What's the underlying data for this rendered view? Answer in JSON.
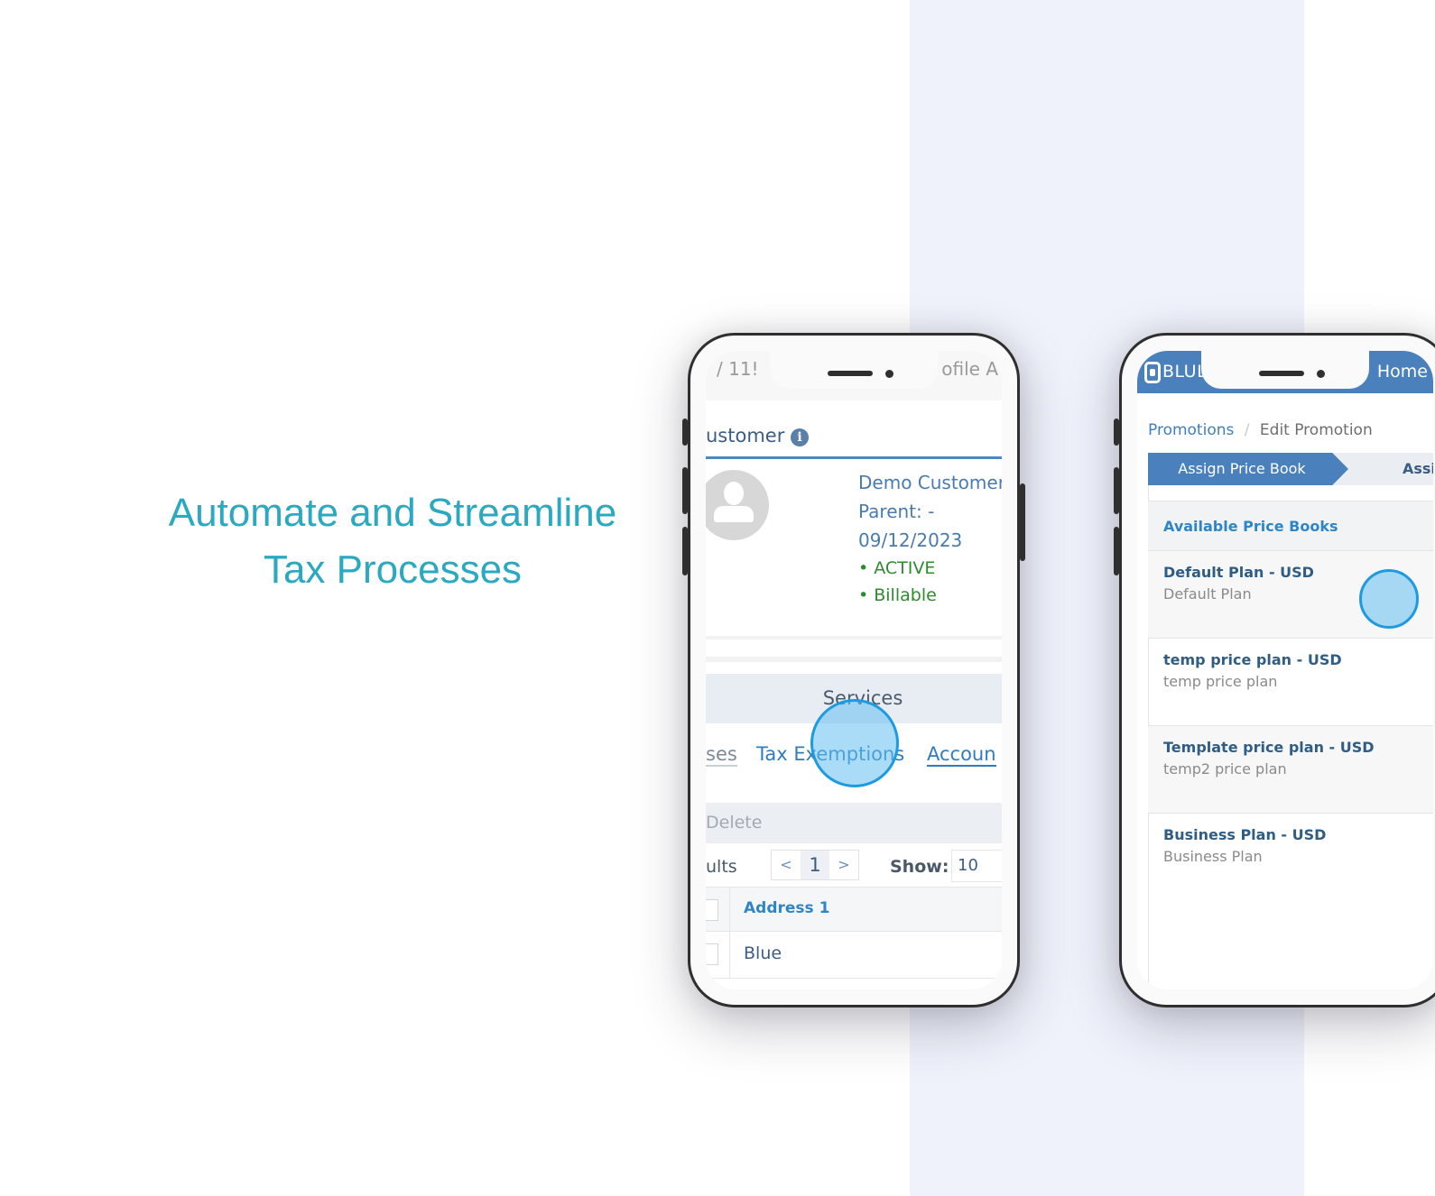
{
  "headline": {
    "line1": "Automate and Streamline",
    "line2": "Tax Processes",
    "color": "#2aa9c0"
  },
  "phone1": {
    "topbar": {
      "left_fragment": "/ 11!",
      "right_fragment": "ofile A"
    },
    "page_title": "ustomer",
    "info_icon": "info-icon",
    "customer": {
      "name": "Demo Customer",
      "parent": "Parent: -",
      "date": "09/12/2023",
      "status_active": "• ACTIVE",
      "status_billable": "• Billable"
    },
    "section_label": "Services",
    "tabs": [
      {
        "label": "ses"
      },
      {
        "label": "Tax Exemptions"
      },
      {
        "label": "Accoun"
      }
    ],
    "delete_label": "Delete",
    "results_label": "ults",
    "pager": {
      "prev": "<",
      "current": "1",
      "next": ">"
    },
    "show_label": "Show:",
    "show_value": "10",
    "table": {
      "header": "Address 1",
      "rows": [
        {
          "address1": "Blue"
        }
      ]
    }
  },
  "phone2": {
    "brand": "BLULOGIX",
    "home_label": "Home",
    "breadcrumb": {
      "parent": "Promotions",
      "separator": "/",
      "current": "Edit Promotion"
    },
    "wizard": {
      "active_step": "Assign Price Book",
      "next_step": "Assi"
    },
    "price_books_title": "Available Price Books",
    "price_books": [
      {
        "name": "Default Plan - USD",
        "description": "Default Plan"
      },
      {
        "name": "temp price plan - USD",
        "description": "temp price plan"
      },
      {
        "name": "Template price plan - USD",
        "description": "temp2 price plan"
      },
      {
        "name": "Business Plan - USD",
        "description": "Business Plan"
      }
    ]
  },
  "colors": {
    "brand_blue": "#4a81bd",
    "link_blue": "#2f86c6",
    "status_green": "#2e8b2e",
    "tap_indicator": "#1e9be0",
    "background_panel": "#eff2fb"
  }
}
